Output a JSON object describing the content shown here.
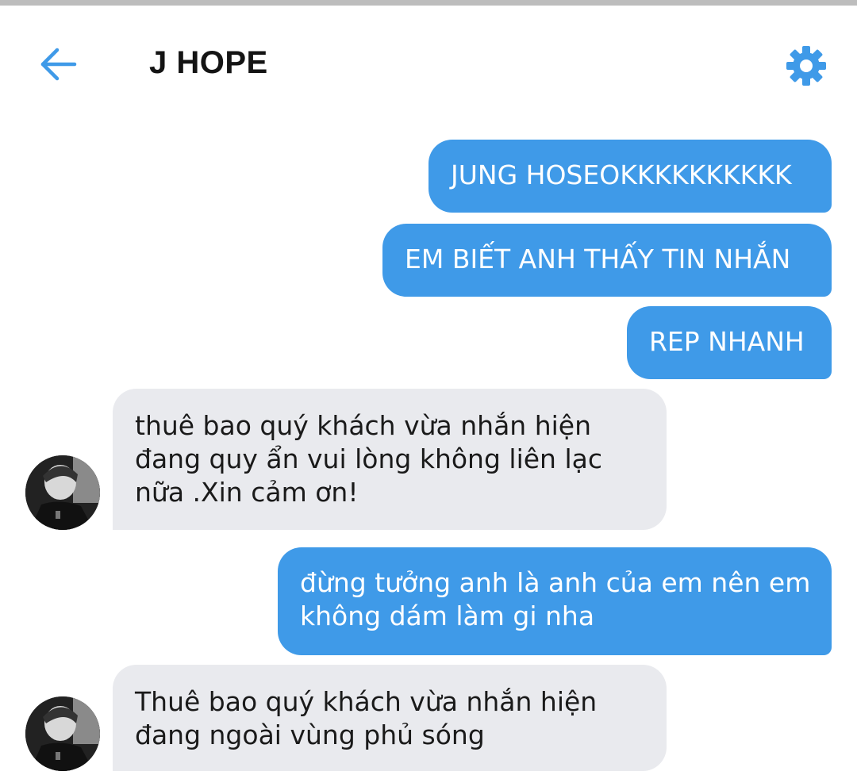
{
  "header": {
    "title": "J HOPE"
  },
  "icons": {
    "back": "arrow-left-icon",
    "settings": "gear-icon",
    "avatar": "contact-avatar"
  },
  "colors": {
    "accent": "#3f9ae8",
    "outgoing_bubble": "#3f9ae8",
    "incoming_bubble": "#e9eaee",
    "title_text": "#141414"
  },
  "messages": [
    {
      "direction": "outgoing",
      "lines": [
        "JUNG HOSEOKKKKKKKKKK"
      ]
    },
    {
      "direction": "outgoing",
      "lines": [
        "EM BIẾT ANH THẤY TIN NHẮN"
      ]
    },
    {
      "direction": "outgoing",
      "lines": [
        "REP NHANH"
      ]
    },
    {
      "direction": "incoming",
      "lines": [
        "thuê bao quý khách vừa nhắn hiện",
        "đang quy ẩn vui lòng không liên lạc",
        "nữa .Xin cảm ơn!"
      ]
    },
    {
      "direction": "outgoing",
      "lines": [
        "đừng tưởng anh là anh của em nên em",
        "không dám làm gi nha"
      ]
    },
    {
      "direction": "incoming",
      "lines": [
        "Thuê bao quý khách vừa nhắn hiện",
        "đang ngoài vùng phủ sóng"
      ]
    }
  ]
}
